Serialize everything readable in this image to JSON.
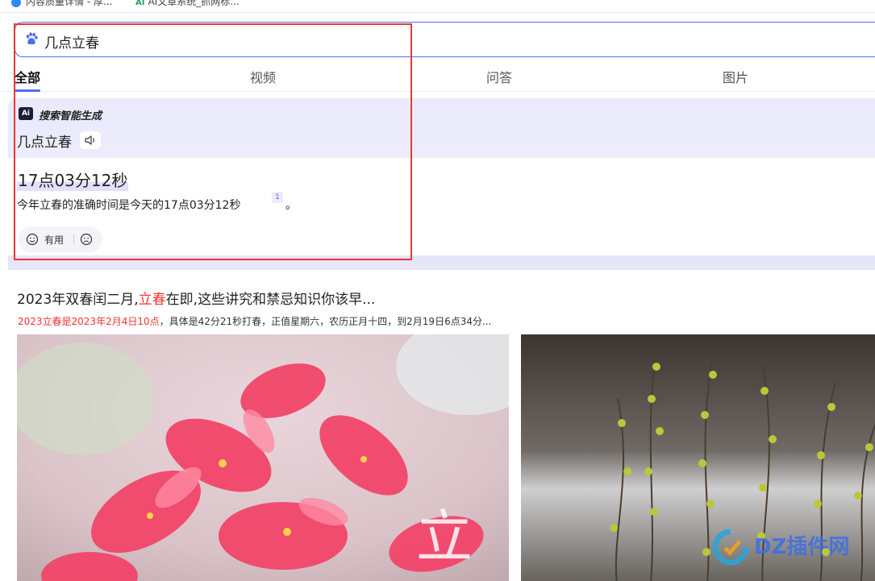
{
  "bookmarks": [
    {
      "label": "内容质量详情 - 厚..."
    },
    {
      "label": "AI文章系统_抓网标..."
    }
  ],
  "search": {
    "query": "几点立春"
  },
  "tabs": [
    {
      "label": "全部",
      "active": true
    },
    {
      "label": "视频"
    },
    {
      "label": "问答"
    },
    {
      "label": "图片"
    }
  ],
  "ai_card": {
    "badge": "Ai",
    "brand": "搜索智能生成",
    "query": "几点立春",
    "answer_big": "17点03分12秒",
    "answer_text": "今年立春的准确时间是今天的17点03分12秒",
    "cite": "1",
    "period": "。",
    "feedback_useful": "有用"
  },
  "result": {
    "title_pre": "2023年双春闰二月,",
    "title_hl": "立春",
    "title_post": "在即,这些讲究和禁忌知识你该早...",
    "sub_hl": "2023立春是2023年2月4日10点",
    "sub_rest": "，具体是42分21秒打春，正值星期六，农历正月十四，到2月19日6点34分..."
  },
  "watermark": {
    "text": "DZ插件网"
  },
  "colors": {
    "accent": "#4e6ef2",
    "highlight_red": "#f73131",
    "annotation_red": "#e53935",
    "ai_bg": "#ececfc"
  }
}
